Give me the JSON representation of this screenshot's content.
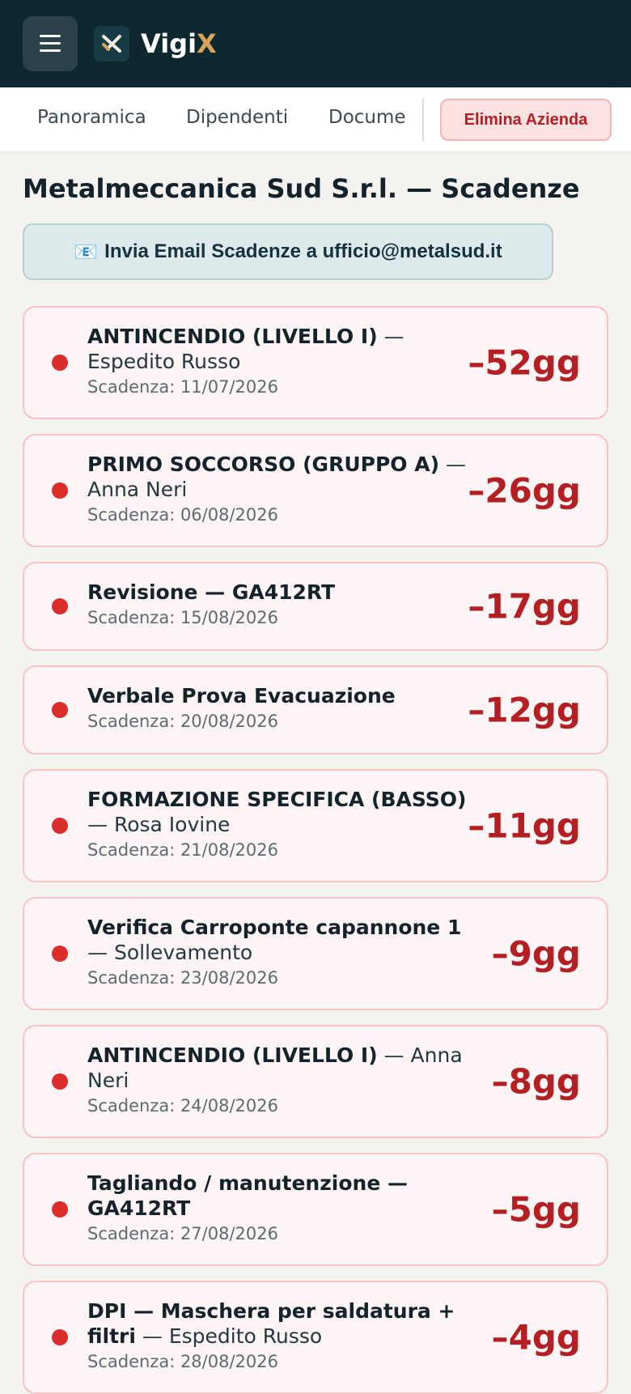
{
  "app": {
    "name_main": "Vigi",
    "name_accent": "X",
    "accent_color": "#d9a35a",
    "header_color": "#0e2830"
  },
  "header": {
    "menu_icon": "hamburger-icon",
    "logo_icon": "vigix-logo-icon"
  },
  "tabs": [
    {
      "label": "Panoramica"
    },
    {
      "label": "Dipendenti"
    },
    {
      "label": "Docume"
    }
  ],
  "actions": {
    "delete_label": "Elimina Azienda",
    "delete_color": "#b41f24"
  },
  "page": {
    "title": "Metalmeccanica Sud S.r.l. — Scadenze",
    "email_icon": "📧",
    "email_label": "Invia Email Scadenze a ufficio@metalsud.it"
  },
  "deadlines": [
    {
      "title": "ANTINCENDIO (LIVELLO I)",
      "subject": "— Espedito Russo",
      "due": "Scadenza: 11/07/2026",
      "days": "–52gg"
    },
    {
      "title": "PRIMO SOCCORSO (GRUPPO A)",
      "subject": "— Anna Neri",
      "due": "Scadenza: 06/08/2026",
      "days": "–26gg"
    },
    {
      "title": "Revisione — GA412RT",
      "subject": "",
      "due": "Scadenza: 15/08/2026",
      "days": "–17gg"
    },
    {
      "title": "Verbale Prova Evacuazione",
      "subject": "",
      "due": "Scadenza: 20/08/2026",
      "days": "–12gg"
    },
    {
      "title": "FORMAZIONE SPECIFICA (BASSO)",
      "subject": "— Rosa Iovine",
      "due": "Scadenza: 21/08/2026",
      "days": "–11gg"
    },
    {
      "title": "Verifica Carroponte capannone 1",
      "subject": "— Sollevamento",
      "due": "Scadenza: 23/08/2026",
      "days": "–9gg"
    },
    {
      "title": "ANTINCENDIO (LIVELLO I)",
      "subject": "— Anna Neri",
      "due": "Scadenza: 24/08/2026",
      "days": "–8gg"
    },
    {
      "title": "Tagliando / manutenzione — GA412RT",
      "subject": "",
      "due": "Scadenza: 27/08/2026",
      "days": "–5gg"
    },
    {
      "title": "DPI — Maschera per saldatura + filtri",
      "subject": "— Espedito Russo",
      "due": "Scadenza: 28/08/2026",
      "days": "–4gg"
    }
  ]
}
